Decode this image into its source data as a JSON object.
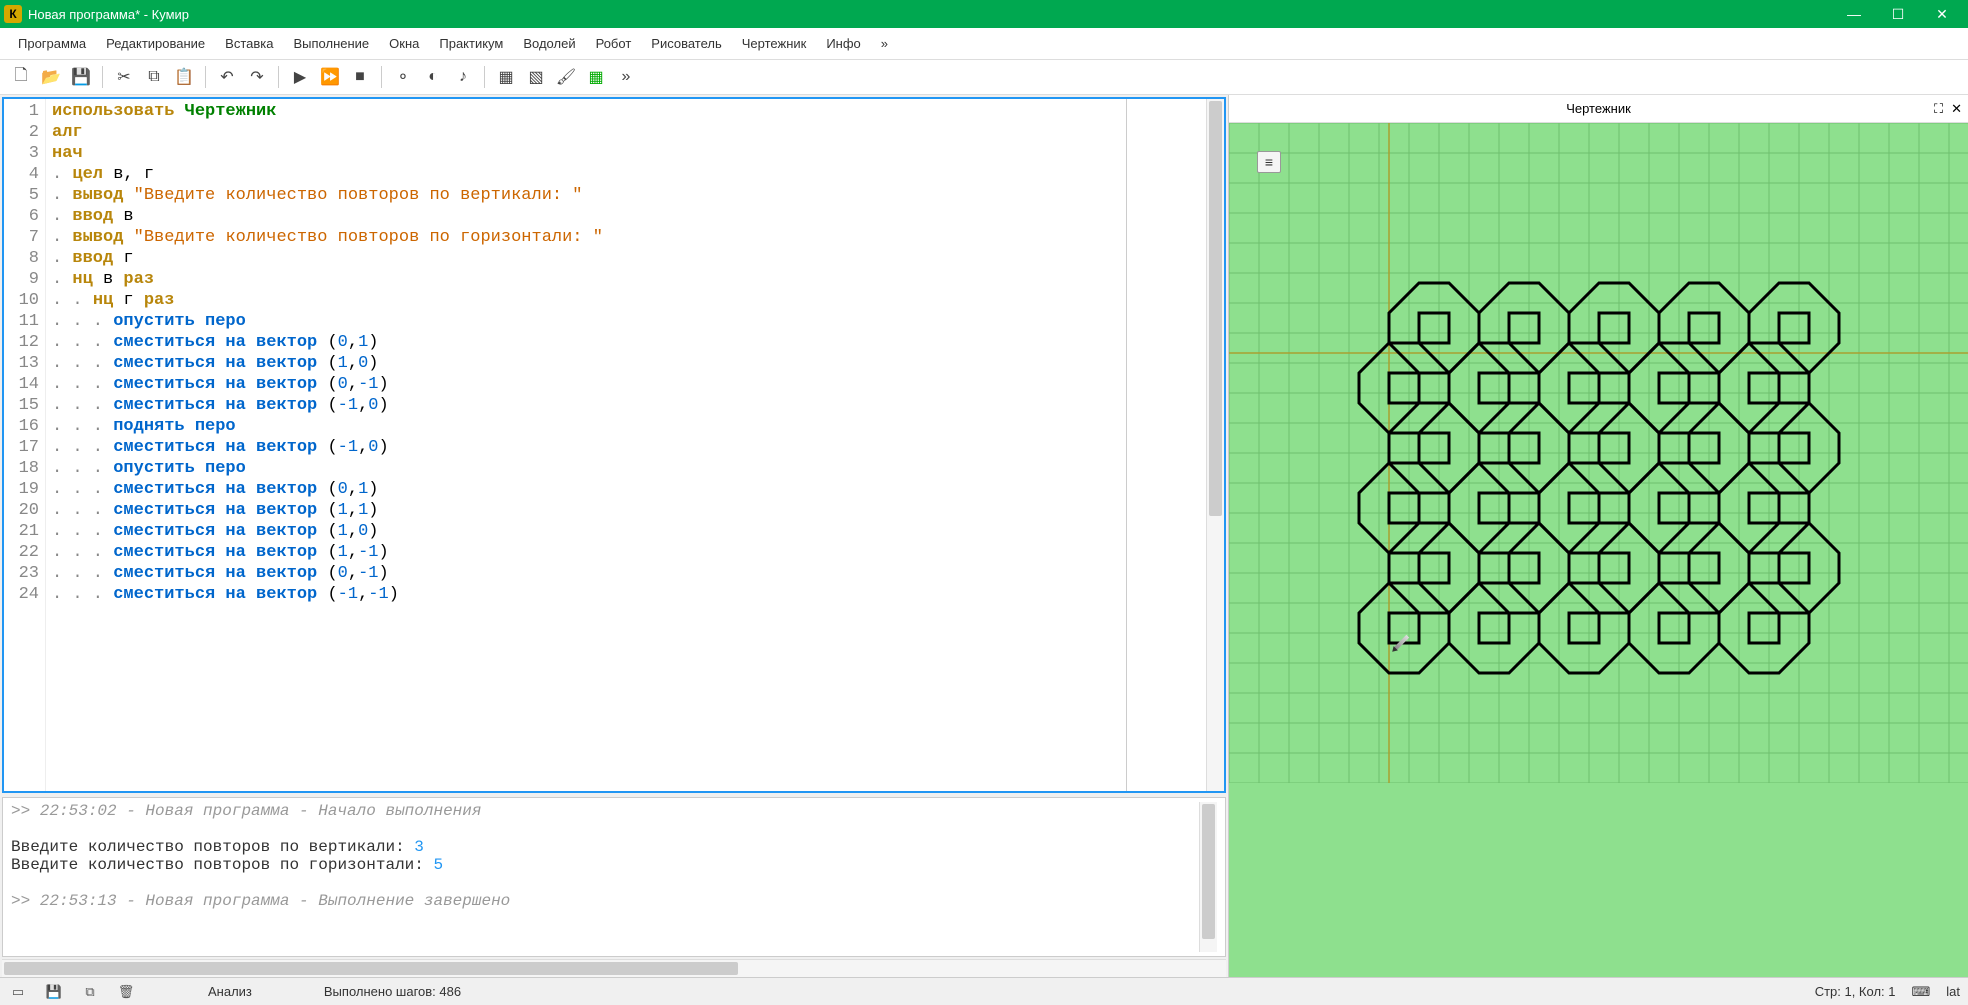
{
  "window": {
    "title": "Новая программа* - Кумир",
    "icon_letter": "К"
  },
  "menu": [
    "Программа",
    "Редактирование",
    "Вставка",
    "Выполнение",
    "Окна",
    "Практикум",
    "Водолей",
    "Робот",
    "Рисователь",
    "Чертежник",
    "Инфо",
    "»"
  ],
  "drawer": {
    "title": "Чертежник"
  },
  "code_lines": [
    {
      "n": 1,
      "tokens": [
        {
          "t": "использовать ",
          "c": "kw"
        },
        {
          "t": "Чертежник",
          "c": "id"
        }
      ]
    },
    {
      "n": 2,
      "tokens": [
        {
          "t": "алг",
          "c": "kw"
        }
      ]
    },
    {
      "n": 3,
      "tokens": [
        {
          "t": "нач",
          "c": "kw"
        }
      ]
    },
    {
      "n": 4,
      "tokens": [
        {
          "t": ". ",
          "c": "dot"
        },
        {
          "t": "цел ",
          "c": "kw"
        },
        {
          "t": "в, г",
          "c": ""
        }
      ]
    },
    {
      "n": 5,
      "tokens": [
        {
          "t": ". ",
          "c": "dot"
        },
        {
          "t": "вывод ",
          "c": "kw"
        },
        {
          "t": "\"Введите количество повторов по вертикали: \"",
          "c": "str"
        }
      ]
    },
    {
      "n": 6,
      "tokens": [
        {
          "t": ". ",
          "c": "dot"
        },
        {
          "t": "ввод ",
          "c": "kw"
        },
        {
          "t": "в",
          "c": ""
        }
      ]
    },
    {
      "n": 7,
      "tokens": [
        {
          "t": ". ",
          "c": "dot"
        },
        {
          "t": "вывод ",
          "c": "kw"
        },
        {
          "t": "\"Введите количество повторов по горизонтали: \"",
          "c": "str"
        }
      ]
    },
    {
      "n": 8,
      "tokens": [
        {
          "t": ". ",
          "c": "dot"
        },
        {
          "t": "ввод ",
          "c": "kw"
        },
        {
          "t": "г",
          "c": ""
        }
      ]
    },
    {
      "n": 9,
      "tokens": [
        {
          "t": ". ",
          "c": "dot"
        },
        {
          "t": "нц ",
          "c": "kw"
        },
        {
          "t": "в ",
          "c": ""
        },
        {
          "t": "раз",
          "c": "kw"
        }
      ]
    },
    {
      "n": 10,
      "tokens": [
        {
          "t": ". . ",
          "c": "dot"
        },
        {
          "t": "нц ",
          "c": "kw"
        },
        {
          "t": "г ",
          "c": ""
        },
        {
          "t": "раз",
          "c": "kw"
        }
      ]
    },
    {
      "n": 11,
      "tokens": [
        {
          "t": ". . . ",
          "c": "dot"
        },
        {
          "t": "опустить перо",
          "c": "kw2"
        }
      ]
    },
    {
      "n": 12,
      "tokens": [
        {
          "t": ". . . ",
          "c": "dot"
        },
        {
          "t": "сместиться на вектор ",
          "c": "kw2"
        },
        {
          "t": "(",
          "c": ""
        },
        {
          "t": "0",
          "c": "num"
        },
        {
          "t": ",",
          "c": ""
        },
        {
          "t": "1",
          "c": "num"
        },
        {
          "t": ")",
          "c": ""
        }
      ]
    },
    {
      "n": 13,
      "tokens": [
        {
          "t": ". . . ",
          "c": "dot"
        },
        {
          "t": "сместиться на вектор ",
          "c": "kw2"
        },
        {
          "t": "(",
          "c": ""
        },
        {
          "t": "1",
          "c": "num"
        },
        {
          "t": ",",
          "c": ""
        },
        {
          "t": "0",
          "c": "num"
        },
        {
          "t": ")",
          "c": ""
        }
      ]
    },
    {
      "n": 14,
      "tokens": [
        {
          "t": ". . . ",
          "c": "dot"
        },
        {
          "t": "сместиться на вектор ",
          "c": "kw2"
        },
        {
          "t": "(",
          "c": ""
        },
        {
          "t": "0",
          "c": "num"
        },
        {
          "t": ",",
          "c": ""
        },
        {
          "t": "-1",
          "c": "num"
        },
        {
          "t": ")",
          "c": ""
        }
      ]
    },
    {
      "n": 15,
      "tokens": [
        {
          "t": ". . . ",
          "c": "dot"
        },
        {
          "t": "сместиться на вектор ",
          "c": "kw2"
        },
        {
          "t": "(",
          "c": ""
        },
        {
          "t": "-1",
          "c": "num"
        },
        {
          "t": ",",
          "c": ""
        },
        {
          "t": "0",
          "c": "num"
        },
        {
          "t": ")",
          "c": ""
        }
      ]
    },
    {
      "n": 16,
      "tokens": [
        {
          "t": ". . . ",
          "c": "dot"
        },
        {
          "t": "поднять перо",
          "c": "kw2"
        }
      ]
    },
    {
      "n": 17,
      "tokens": [
        {
          "t": ". . . ",
          "c": "dot"
        },
        {
          "t": "сместиться на вектор ",
          "c": "kw2"
        },
        {
          "t": "(",
          "c": ""
        },
        {
          "t": "-1",
          "c": "num"
        },
        {
          "t": ",",
          "c": ""
        },
        {
          "t": "0",
          "c": "num"
        },
        {
          "t": ")",
          "c": ""
        }
      ]
    },
    {
      "n": 18,
      "tokens": [
        {
          "t": ". . . ",
          "c": "dot"
        },
        {
          "t": "опустить перо",
          "c": "kw2"
        }
      ]
    },
    {
      "n": 19,
      "tokens": [
        {
          "t": ". . . ",
          "c": "dot"
        },
        {
          "t": "сместиться на вектор ",
          "c": "kw2"
        },
        {
          "t": "(",
          "c": ""
        },
        {
          "t": "0",
          "c": "num"
        },
        {
          "t": ",",
          "c": ""
        },
        {
          "t": "1",
          "c": "num"
        },
        {
          "t": ")",
          "c": ""
        }
      ]
    },
    {
      "n": 20,
      "tokens": [
        {
          "t": ". . . ",
          "c": "dot"
        },
        {
          "t": "сместиться на вектор ",
          "c": "kw2"
        },
        {
          "t": "(",
          "c": ""
        },
        {
          "t": "1",
          "c": "num"
        },
        {
          "t": ",",
          "c": ""
        },
        {
          "t": "1",
          "c": "num"
        },
        {
          "t": ")",
          "c": ""
        }
      ]
    },
    {
      "n": 21,
      "tokens": [
        {
          "t": ". . . ",
          "c": "dot"
        },
        {
          "t": "сместиться на вектор ",
          "c": "kw2"
        },
        {
          "t": "(",
          "c": ""
        },
        {
          "t": "1",
          "c": "num"
        },
        {
          "t": ",",
          "c": ""
        },
        {
          "t": "0",
          "c": "num"
        },
        {
          "t": ")",
          "c": ""
        }
      ]
    },
    {
      "n": 22,
      "tokens": [
        {
          "t": ". . . ",
          "c": "dot"
        },
        {
          "t": "сместиться на вектор ",
          "c": "kw2"
        },
        {
          "t": "(",
          "c": ""
        },
        {
          "t": "1",
          "c": "num"
        },
        {
          "t": ",",
          "c": ""
        },
        {
          "t": "-1",
          "c": "num"
        },
        {
          "t": ")",
          "c": ""
        }
      ]
    },
    {
      "n": 23,
      "tokens": [
        {
          "t": ". . . ",
          "c": "dot"
        },
        {
          "t": "сместиться на вектор ",
          "c": "kw2"
        },
        {
          "t": "(",
          "c": ""
        },
        {
          "t": "0",
          "c": "num"
        },
        {
          "t": ",",
          "c": ""
        },
        {
          "t": "-1",
          "c": "num"
        },
        {
          "t": ")",
          "c": ""
        }
      ]
    },
    {
      "n": 24,
      "tokens": [
        {
          "t": ". . . ",
          "c": "dot"
        },
        {
          "t": "сместиться на вектор ",
          "c": "kw2"
        },
        {
          "t": "(",
          "c": ""
        },
        {
          "t": "-1",
          "c": "num"
        },
        {
          "t": ",",
          "c": ""
        },
        {
          "t": "-1",
          "c": "num"
        },
        {
          "t": ")",
          "c": ""
        }
      ]
    }
  ],
  "console": {
    "line1": ">> 22:53:02 - Новая программа - Начало выполнения",
    "prompt1": "Введите количество повторов по вертикали: ",
    "value1": "3",
    "prompt2": "Введите количество повторов по горизонтали: ",
    "value2": "5",
    "line2": ">> 22:53:13 - Новая программа - Выполнение завершено"
  },
  "status": {
    "analysis": "Анализ",
    "steps": "Выполнено шагов: 486",
    "pos": "Стр: 1, Кол: 1",
    "lang": "lat"
  }
}
